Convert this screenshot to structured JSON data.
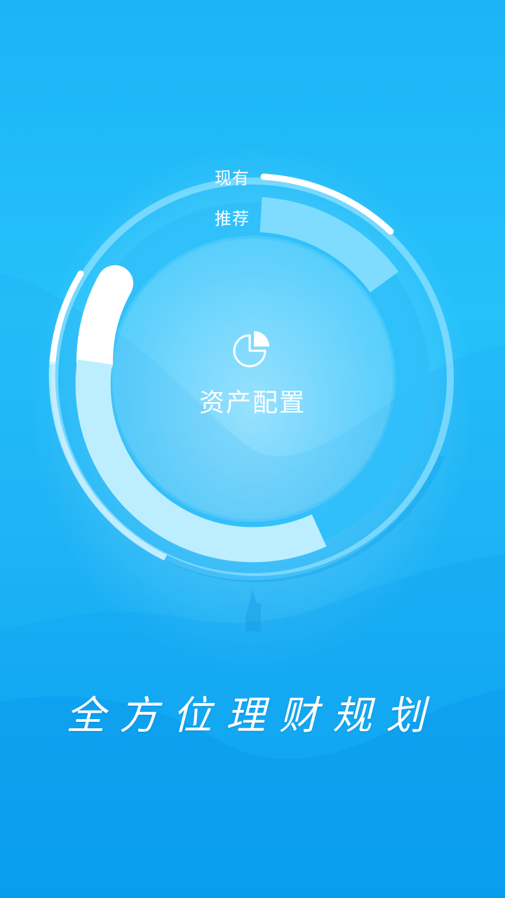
{
  "legend": {
    "current_label": "现有",
    "recommended_label": "推荐"
  },
  "center": {
    "icon": "pie-chart-icon",
    "title": "资产配置"
  },
  "slogan": "全方位理财规划",
  "colors": {
    "background_top": "#1bb4f6",
    "background_bottom": "#0aa3f4",
    "ring_white": "#ffffff",
    "ring_light": "#b9ecff",
    "ring_mid": "#6fd8ff"
  }
}
